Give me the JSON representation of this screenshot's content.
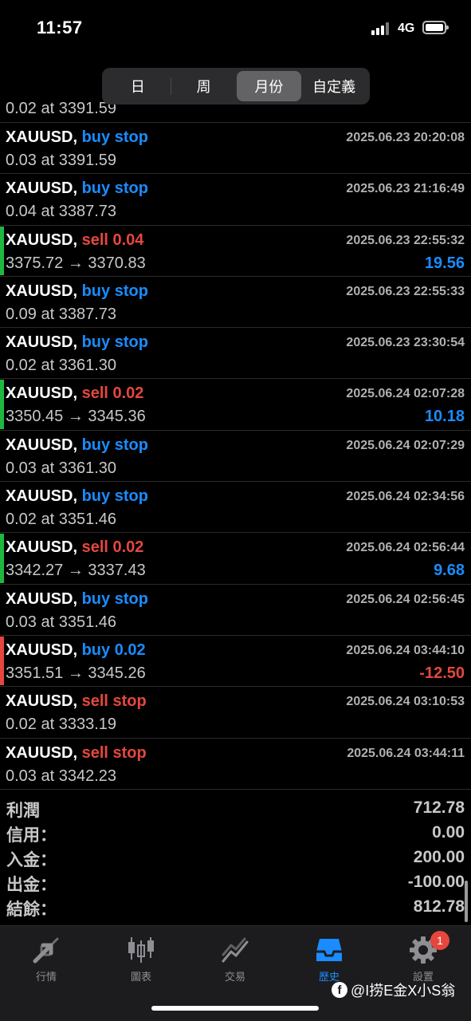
{
  "status_bar": {
    "time": "11:57",
    "network": "4G"
  },
  "period_tabs": [
    {
      "label": "日",
      "active": false
    },
    {
      "label": "周",
      "active": false
    },
    {
      "label": "月份",
      "active": true
    },
    {
      "label": "自定義",
      "active": false
    }
  ],
  "partial_row_text": "0.02 at 3391.59",
  "orders": [
    {
      "symbol": "XAUUSD,",
      "type": "buy stop",
      "type_color": "blue",
      "datetime": "2025.06.23 20:20:08",
      "detail": "0.03 at 3391.59",
      "pl": "",
      "bar": ""
    },
    {
      "symbol": "XAUUSD,",
      "type": "buy stop",
      "type_color": "blue",
      "datetime": "2025.06.23 21:16:49",
      "detail": "0.04 at 3387.73",
      "pl": "",
      "bar": ""
    },
    {
      "symbol": "XAUUSD,",
      "type": "sell 0.04",
      "type_color": "red",
      "datetime": "2025.06.23 22:55:32",
      "detail": "3375.72 → 3370.83",
      "pl": "19.56",
      "bar": "#1fb83f"
    },
    {
      "symbol": "XAUUSD,",
      "type": "buy stop",
      "type_color": "blue",
      "datetime": "2025.06.23 22:55:33",
      "detail": "0.09 at 3387.73",
      "pl": "",
      "bar": ""
    },
    {
      "symbol": "XAUUSD,",
      "type": "buy stop",
      "type_color": "blue",
      "datetime": "2025.06.23 23:30:54",
      "detail": "0.02 at 3361.30",
      "pl": "",
      "bar": ""
    },
    {
      "symbol": "XAUUSD,",
      "type": "sell 0.02",
      "type_color": "red",
      "datetime": "2025.06.24 02:07:28",
      "detail": "3350.45 → 3345.36",
      "pl": "10.18",
      "bar": "#1fb83f"
    },
    {
      "symbol": "XAUUSD,",
      "type": "buy stop",
      "type_color": "blue",
      "datetime": "2025.06.24 02:07:29",
      "detail": "0.03 at 3361.30",
      "pl": "",
      "bar": ""
    },
    {
      "symbol": "XAUUSD,",
      "type": "buy stop",
      "type_color": "blue",
      "datetime": "2025.06.24 02:34:56",
      "detail": "0.02 at 3351.46",
      "pl": "",
      "bar": ""
    },
    {
      "symbol": "XAUUSD,",
      "type": "sell 0.02",
      "type_color": "red",
      "datetime": "2025.06.24 02:56:44",
      "detail": "3342.27 → 3337.43",
      "pl": "9.68",
      "bar": "#1fb83f"
    },
    {
      "symbol": "XAUUSD,",
      "type": "buy stop",
      "type_color": "blue",
      "datetime": "2025.06.24 02:56:45",
      "detail": "0.03 at 3351.46",
      "pl": "",
      "bar": ""
    },
    {
      "symbol": "XAUUSD,",
      "type": "buy 0.02",
      "type_color": "blue",
      "datetime": "2025.06.24 03:44:10",
      "detail": "3351.51 → 3345.26",
      "pl": "-12.50",
      "bar": "#e5473d"
    },
    {
      "symbol": "XAUUSD,",
      "type": "sell stop",
      "type_color": "red",
      "datetime": "2025.06.24 03:10:53",
      "detail": "0.02 at 3333.19",
      "pl": "",
      "bar": ""
    },
    {
      "symbol": "XAUUSD,",
      "type": "sell stop",
      "type_color": "red",
      "datetime": "2025.06.24 03:44:11",
      "detail": "0.03 at 3342.23",
      "pl": "",
      "bar": ""
    }
  ],
  "summary": [
    {
      "label": "利潤",
      "value": "712.78"
    },
    {
      "label": "信用：",
      "value": "0.00"
    },
    {
      "label": "入金：",
      "value": "200.00"
    },
    {
      "label": "出金：",
      "value": "-100.00"
    },
    {
      "label": "結餘：",
      "value": "812.78"
    }
  ],
  "tabs": [
    {
      "label": "行情",
      "icon": "quotes-arrows-icon",
      "active": false
    },
    {
      "label": "圖表",
      "icon": "candlestick-chart-icon",
      "active": false
    },
    {
      "label": "交易",
      "icon": "trade-chart-icon",
      "active": false
    },
    {
      "label": "歷史",
      "icon": "history-inbox-icon",
      "active": true
    },
    {
      "label": "設置",
      "icon": "gear-icon",
      "active": false,
      "badge": "1"
    }
  ],
  "watermark": "@I捞E金X小S翁",
  "colors": {
    "blue": "#1a8cff",
    "red": "#e5473d",
    "green": "#1fb83f"
  }
}
